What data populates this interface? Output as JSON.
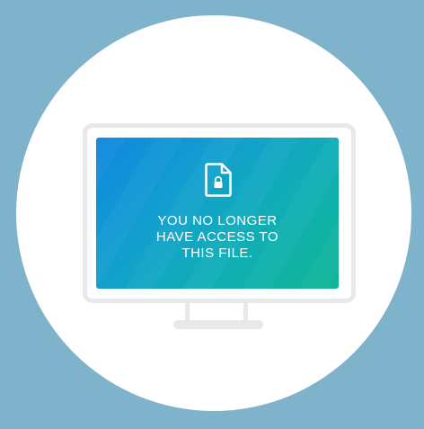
{
  "message": {
    "line1": "YOU NO LONGER",
    "line2": "HAVE ACCESS TO",
    "line3": "THIS FILE."
  },
  "icons": {
    "file": "locked-file-icon",
    "lock": "lock-icon"
  },
  "colors": {
    "background": "#7fb3cc",
    "circle": "#ffffff",
    "monitor_frame": "#e6e8ea",
    "screen_gradient_start": "#0f87df",
    "screen_gradient_end": "#10b594",
    "text": "#ffffff"
  }
}
